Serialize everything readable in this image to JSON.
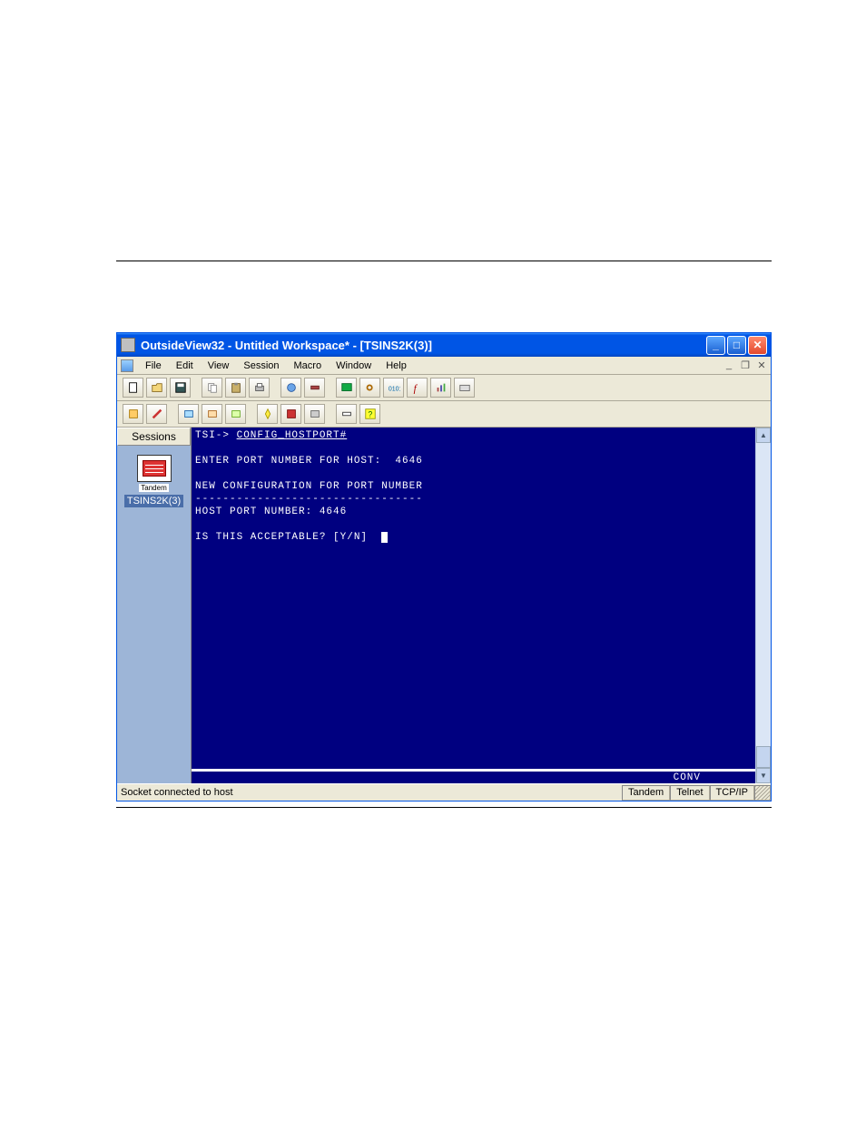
{
  "window": {
    "title": "OutsideView32 - Untitled Workspace* - [TSINS2K(3)]"
  },
  "menu": {
    "items": [
      "File",
      "Edit",
      "View",
      "Session",
      "Macro",
      "Window",
      "Help"
    ]
  },
  "sessions": {
    "header": "Sessions",
    "item_caption": "Tandem",
    "item_label": "TSINS2K(3)"
  },
  "terminal": {
    "line1_prefix": "TSI-> ",
    "line1_cmd": "CONFIG_HOSTPORT#",
    "line2": "ENTER PORT NUMBER FOR HOST:  4646",
    "line3": "NEW CONFIGURATION FOR PORT NUMBER",
    "line4": "---------------------------------",
    "line5": "HOST PORT NUMBER: 4646",
    "line6": "IS THIS ACCEPTABLE? [Y/N]  ",
    "status_right": "CONV"
  },
  "statusbar": {
    "main": "Socket connected to host",
    "cell1": "Tandem",
    "cell2": "Telnet",
    "cell3": "TCP/IP"
  }
}
